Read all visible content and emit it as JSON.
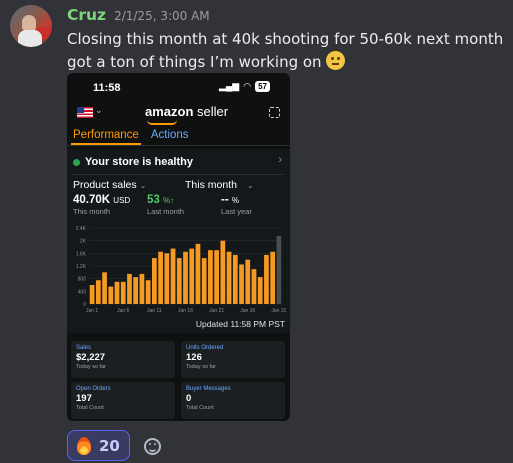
{
  "message": {
    "username": "Cruz",
    "timestamp": "2/1/25, 3:00 AM",
    "text": "Closing this month at 40k shooting for 50-60k next month got a ton of things I’m working on",
    "emoji": "saluting-face-emoji"
  },
  "colors": {
    "username": "#7ed67a",
    "accent_orange": "#ff9900",
    "link_blue": "#6aa9ff",
    "healthy_green": "#2ea44f",
    "reaction_border": "#5865f2"
  },
  "phone": {
    "status_time": "11:58",
    "battery": "57",
    "brand": {
      "amazon": "amazon",
      "seller": "seller"
    },
    "tabs": [
      {
        "label": "Performance",
        "active": true
      },
      {
        "label": "Actions",
        "active": false
      }
    ],
    "store_health": "Your store is healthy",
    "selectors": {
      "metric": "Product sales",
      "period": "This month"
    },
    "stats": [
      {
        "value": "40.70K",
        "unit": "USD",
        "label": "This month"
      },
      {
        "value": "53",
        "unit": "%↑",
        "label": "Last month"
      },
      {
        "value": "--",
        "unit": "%",
        "label": "Last year"
      }
    ],
    "updated": "Updated 11:58 PM PST",
    "tiles": [
      {
        "title": "Sales",
        "value": "$2,227",
        "caption": "Today so far"
      },
      {
        "title": "Units Ordered",
        "value": "126",
        "caption": "Today so far"
      },
      {
        "title": "Open Orders",
        "value": "197",
        "caption": "Total Count"
      },
      {
        "title": "Buyer Messages",
        "value": "0",
        "caption": "Total Count"
      }
    ]
  },
  "chart_data": {
    "type": "bar",
    "title": "",
    "xlabel": "",
    "ylabel": "",
    "ylim": [
      0,
      2400
    ],
    "yticks": [
      "2.4K",
      "2K",
      "1.6K",
      "1.2K",
      "800",
      "400",
      "0"
    ],
    "ytick_values": [
      2400,
      2000,
      1600,
      1200,
      800,
      400,
      0
    ],
    "xticks": [
      "Jan 1",
      "Jan 6",
      "Jan 11",
      "Jan 16",
      "Jan 21",
      "Jan 26",
      "Jan 31"
    ],
    "xtick_days": [
      1,
      6,
      11,
      16,
      21,
      26,
      31
    ],
    "days": [
      1,
      2,
      3,
      4,
      5,
      6,
      7,
      8,
      9,
      10,
      11,
      12,
      13,
      14,
      15,
      16,
      17,
      18,
      19,
      20,
      21,
      22,
      23,
      24,
      25,
      26,
      27,
      28,
      29,
      30,
      31
    ],
    "values": [
      600,
      750,
      1000,
      550,
      700,
      700,
      950,
      850,
      950,
      750,
      1450,
      1650,
      1600,
      1750,
      1450,
      1650,
      1750,
      1900,
      1450,
      1700,
      1700,
      2000,
      1650,
      1550,
      1250,
      1400,
      1100,
      850,
      1550,
      1650,
      2150
    ],
    "bar_color": "#f59a23",
    "last_bar_color": "#4a4d50",
    "grid": true
  },
  "reaction": {
    "emoji": "fire-emoji",
    "count": "20"
  }
}
